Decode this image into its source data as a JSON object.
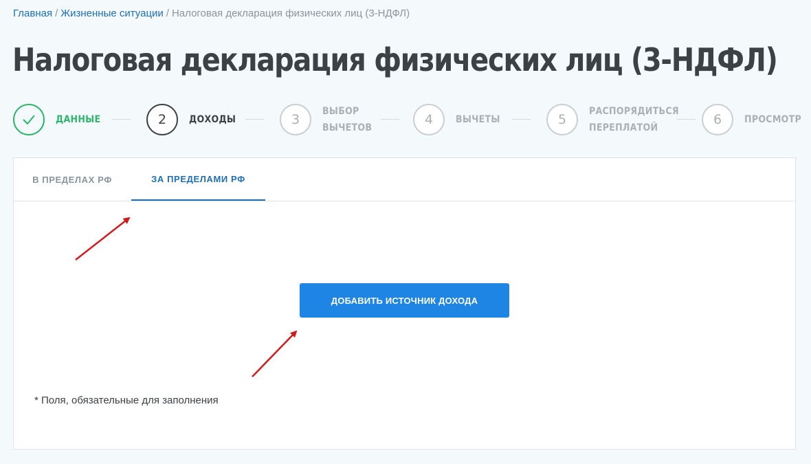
{
  "breadcrumb": {
    "home": "Главная",
    "life": "Жизненные ситуации",
    "current": "Налоговая декларация физических лиц (3-НДФЛ)",
    "separator": "/"
  },
  "page_title": "Налоговая декларация физических лиц (3-НДФЛ)",
  "stepper": {
    "steps": [
      {
        "number": "",
        "icon": "check-icon",
        "label_line1": "ДАННЫЕ",
        "label_line2": "",
        "state": "done"
      },
      {
        "number": "2",
        "label_line1": "ДОХОДЫ",
        "label_line2": "",
        "state": "active"
      },
      {
        "number": "3",
        "label_line1": "ВЫБОР",
        "label_line2": "ВЫЧЕТОВ",
        "state": "pending"
      },
      {
        "number": "4",
        "label_line1": "ВЫЧЕТЫ",
        "label_line2": "",
        "state": "pending"
      },
      {
        "number": "5",
        "label_line1": "РАСПОРЯДИТЬСЯ",
        "label_line2": "ПЕРЕПЛАТОЙ",
        "state": "pending"
      },
      {
        "number": "6",
        "label_line1": "ПРОСМОТР",
        "label_line2": "",
        "state": "pending"
      }
    ]
  },
  "tabs": [
    {
      "label": "В ПРЕДЕЛАХ РФ",
      "active": false
    },
    {
      "label": "ЗА ПРЕДЕЛАМИ РФ",
      "active": true
    }
  ],
  "add_button_label": "ДОБАВИТЬ ИСТОЧНИК ДОХОДА",
  "required_note": "* Поля, обязательные для заполнения",
  "colors": {
    "success": "#2db56b",
    "accent": "#1e6fb6",
    "button": "#1e85e5",
    "annotation_arrow": "#d11a1a"
  }
}
